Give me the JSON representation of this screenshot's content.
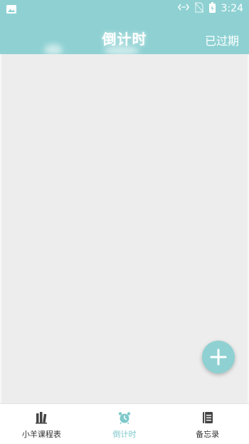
{
  "status_bar": {
    "time": "3:24",
    "icons": [
      "image-notification-icon",
      "data-transfer-icon",
      "no-sim-icon",
      "battery-charging-icon"
    ]
  },
  "app_bar": {
    "title": "倒计时",
    "action_label": "已过期"
  },
  "fab": {
    "icon": "plus-icon"
  },
  "bottom_nav": {
    "items": [
      {
        "label": "小羊课程表",
        "icon": "books-icon",
        "active": false
      },
      {
        "label": "倒计时",
        "icon": "alarm-clock-icon",
        "active": true
      },
      {
        "label": "备忘录",
        "icon": "notebook-icon",
        "active": false
      }
    ]
  },
  "colors": {
    "primary": "#8fd1d3",
    "active_tab": "#7ec8cb",
    "content_bg": "#ededed",
    "inactive_icon": "#444444"
  }
}
